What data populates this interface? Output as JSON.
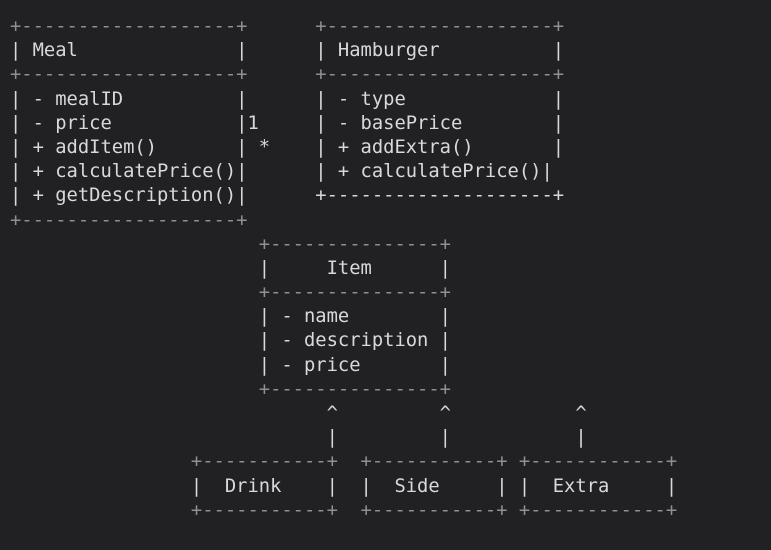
{
  "diagram": {
    "lines": [
      "+-------------------+      +--------------------+",
      "| Meal              |      | Hamburger          |",
      "+-------------------+      +--------------------+",
      "| - mealID          |      | - type             |",
      "| - price           |1     | - basePrice        |",
      "| + addItem()       | *    | + addExtra()       |",
      "| + calculatePrice()|      | + calculatePrice()|",
      "| + getDescription()|      +--------------------+",
      "+-------------------+",
      "                      +---------------+",
      "                      |     Item      |",
      "                      +---------------+",
      "                      | - name        |",
      "                      | - description |",
      "                      | - price       |",
      "                      +---------------+",
      "                            ^         ^           ^",
      "                            |         |           |",
      "                +-----------+  +-----------+ +------------+",
      "                |  Drink    |  |  Side     | |  Extra     |",
      "                +-----------+  +-----------+ +------------+"
    ]
  }
}
